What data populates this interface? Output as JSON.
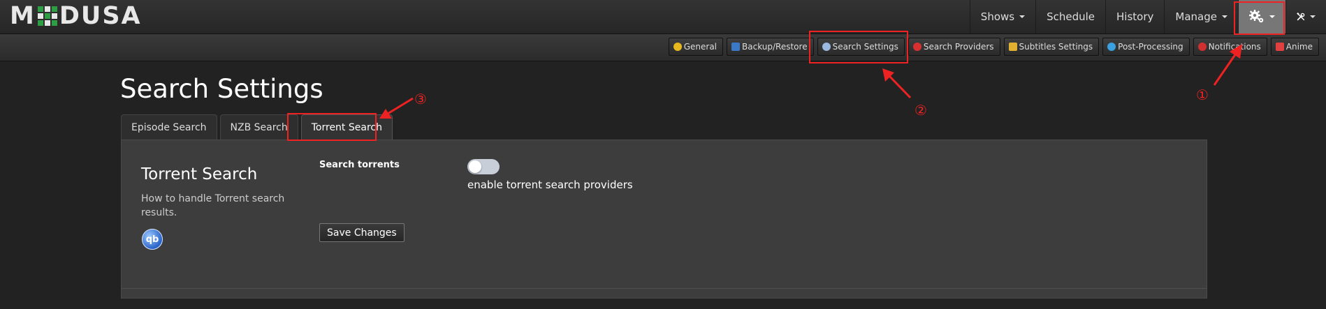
{
  "app": {
    "logo_left": "M",
    "logo_right": "DUSA"
  },
  "nav": {
    "shows": "Shows",
    "schedule": "Schedule",
    "history": "History",
    "manage": "Manage"
  },
  "subnav": [
    {
      "label": "General",
      "icon": "sun-icon",
      "color": "#e8b820"
    },
    {
      "label": "Backup/Restore",
      "icon": "floppy-icon",
      "color": "#3a78c8"
    },
    {
      "label": "Search Settings",
      "icon": "magnifier-icon",
      "color": "#9ab8e0"
    },
    {
      "label": "Search Providers",
      "icon": "provider-icon",
      "color": "#d83030"
    },
    {
      "label": "Subtitles Settings",
      "icon": "subtitles-icon",
      "color": "#e0b030"
    },
    {
      "label": "Post-Processing",
      "icon": "post-processing-icon",
      "color": "#3aa0e0"
    },
    {
      "label": "Notifications",
      "icon": "notification-icon",
      "color": "#d03030"
    },
    {
      "label": "Anime",
      "icon": "anime-icon",
      "color": "#e04040"
    }
  ],
  "page": {
    "title": "Search Settings"
  },
  "tabs": [
    {
      "label": "Episode Search"
    },
    {
      "label": "NZB Search"
    },
    {
      "label": "Torrent Search",
      "active": true
    }
  ],
  "section": {
    "title": "Torrent Search",
    "description": "How to handle Torrent search results.",
    "icon": "qbittorrent-icon",
    "icon_text": "qb"
  },
  "fields": {
    "search_torrents_label": "Search torrents",
    "search_torrents_enabled": false,
    "search_torrents_desc": "enable torrent search providers"
  },
  "actions": {
    "save": "Save Changes"
  },
  "annotations": {
    "one": "①",
    "two": "②",
    "three": "③",
    "color": "#e22222"
  }
}
